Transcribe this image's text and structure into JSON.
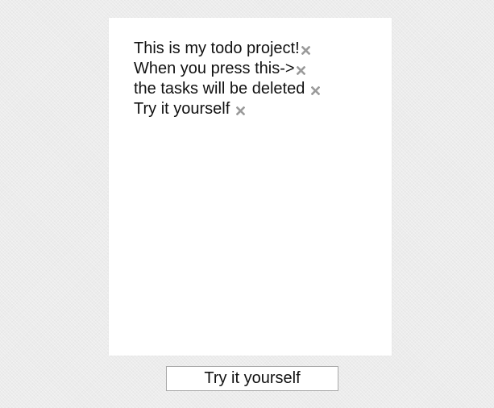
{
  "todos": [
    {
      "text": "This is my todo project!",
      "delete_icon": "close-x-icon"
    },
    {
      "text": "When you press this->",
      "delete_icon": "close-x-icon"
    },
    {
      "text": "the tasks will be deleted",
      "delete_icon": "close-x-icon"
    },
    {
      "text": "Try it yourself",
      "delete_icon": "close-x-icon"
    }
  ],
  "input": {
    "value": "Try it yourself"
  },
  "colors": {
    "background": "#ececec",
    "panel": "#ffffff",
    "text": "#111111",
    "delete_icon": "#9a9a9a",
    "input_border": "#a8a8a8"
  }
}
